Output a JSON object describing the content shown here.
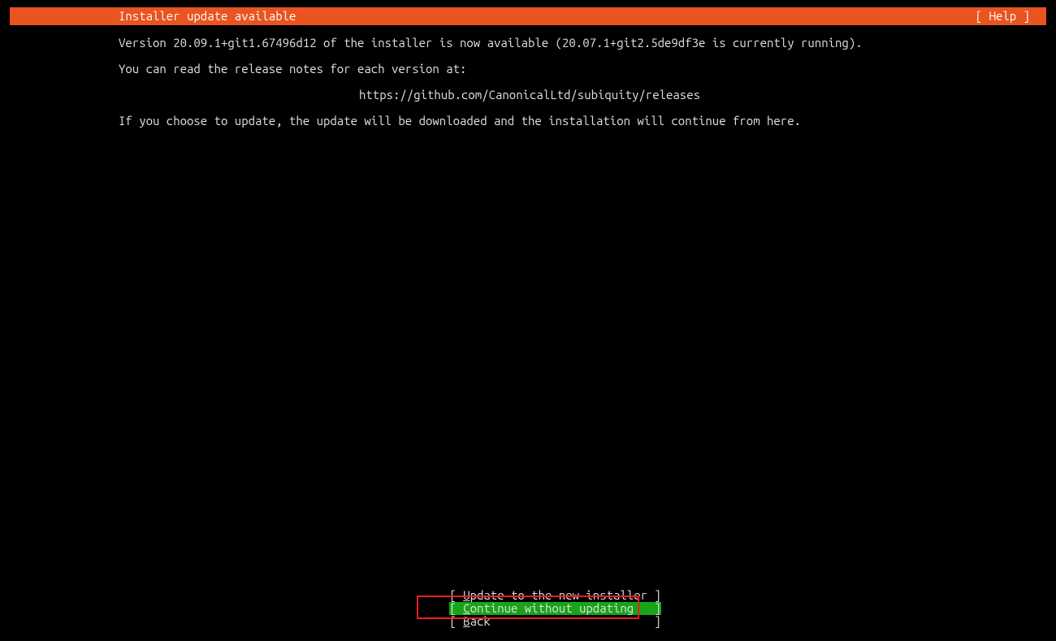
{
  "header": {
    "title": "Installer update available",
    "help": "[ Help ]"
  },
  "body": {
    "version_line": "Version 20.09.1+git1.67496d12 of the installer is now available (20.07.1+git2.5de9df3e is currently running).",
    "release_intro": "You can read the release notes for each version at:",
    "release_url": "https://github.com/CanonicalLtd/subiquity/releases",
    "update_info": "If you choose to update, the update will be downloaded and the installation will continue from here."
  },
  "buttons": {
    "update": {
      "open": "[ ",
      "accel": "U",
      "rest": "pdate to the new installer ",
      "close": "]"
    },
    "continue": {
      "open": "[ ",
      "accel": "C",
      "rest": "ontinue without updating   ",
      "close": "]"
    },
    "back": {
      "open": "[ ",
      "accel": "B",
      "rest": "ack                        ",
      "close": "]"
    }
  }
}
